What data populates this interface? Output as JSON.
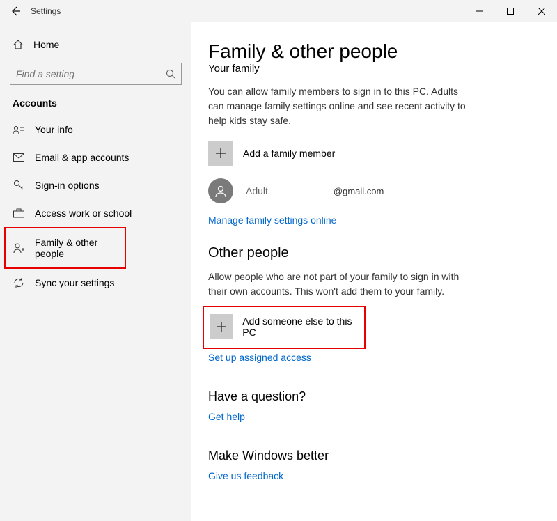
{
  "titlebar": {
    "app_name": "Settings"
  },
  "sidebar": {
    "home_label": "Home",
    "search_placeholder": "Find a setting",
    "section": "Accounts",
    "items": [
      {
        "label": "Your info"
      },
      {
        "label": "Email & app accounts"
      },
      {
        "label": "Sign-in options"
      },
      {
        "label": "Access work or school"
      },
      {
        "label": "Family & other people"
      },
      {
        "label": "Sync your settings"
      }
    ]
  },
  "main": {
    "page_title": "Family & other people",
    "your_family": {
      "heading": "Your family",
      "desc": "You can allow family members to sign in to this PC. Adults can manage family settings online and see recent activity to help kids stay safe.",
      "add_label": "Add a family member",
      "member": {
        "role": "Adult",
        "email": "@gmail.com"
      },
      "manage_link": "Manage family settings online"
    },
    "other_people": {
      "heading": "Other people",
      "desc": "Allow people who are not part of your family to sign in with their own accounts. This won't add them to your family.",
      "add_label": "Add someone else to this PC",
      "assigned_link": "Set up assigned access"
    },
    "question": {
      "heading": "Have a question?",
      "link": "Get help"
    },
    "feedback": {
      "heading": "Make Windows better",
      "link": "Give us feedback"
    }
  }
}
